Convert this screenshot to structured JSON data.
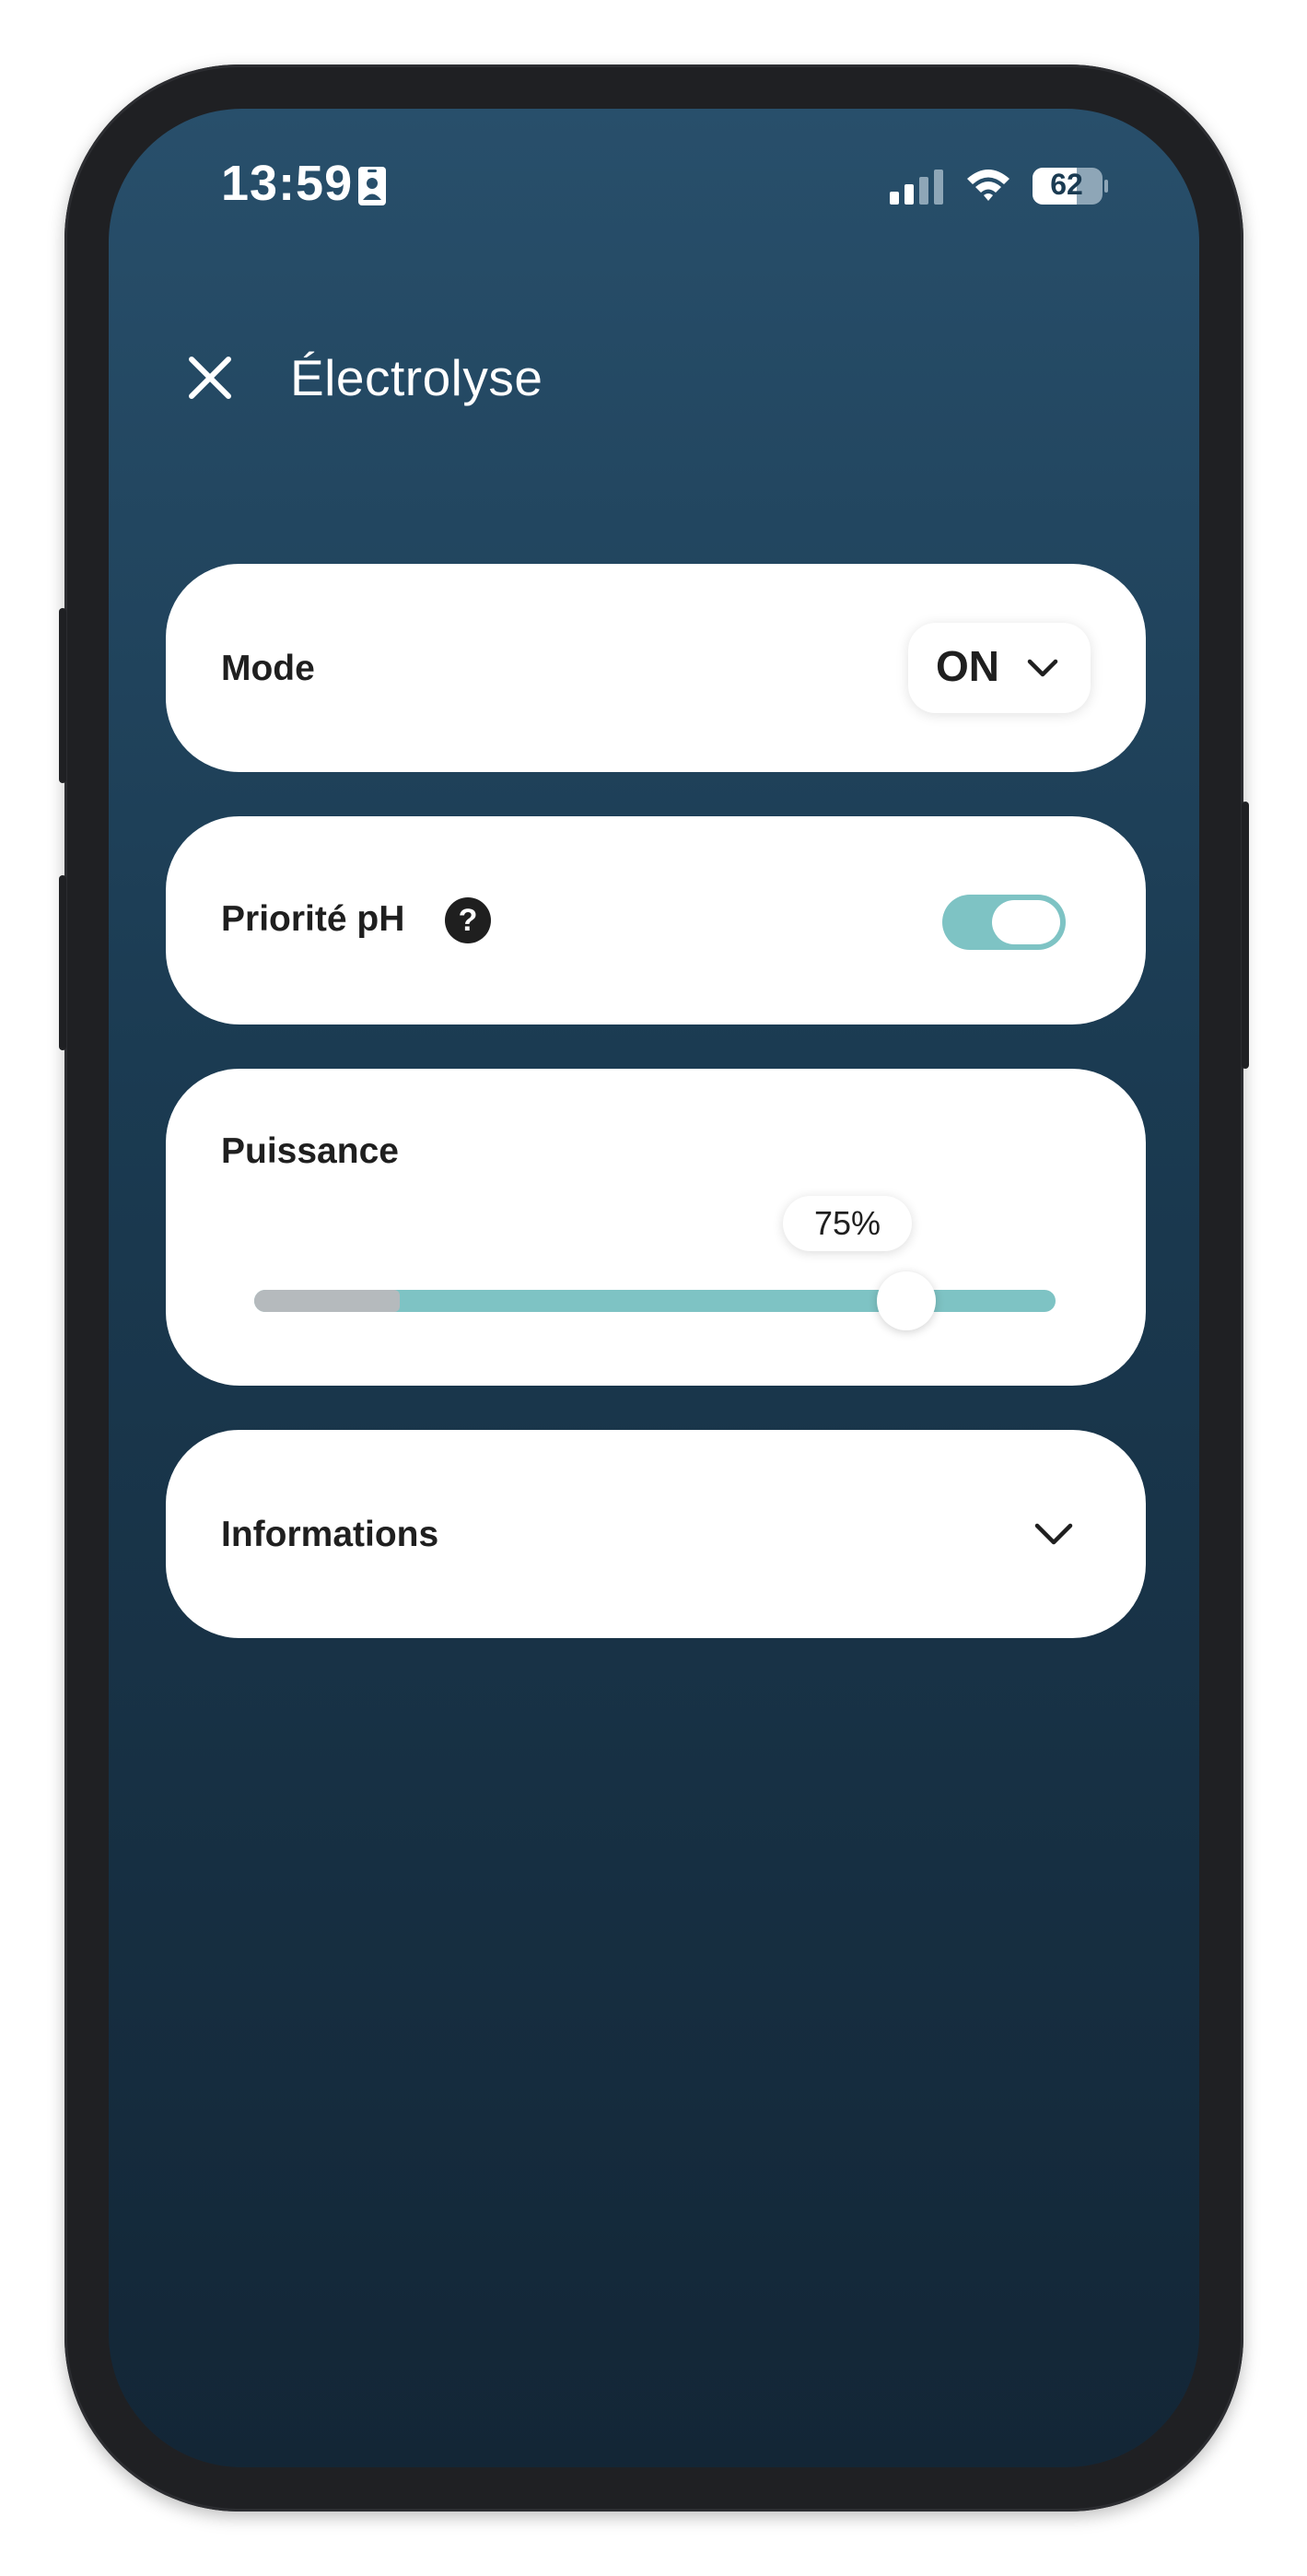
{
  "status_bar": {
    "time": "13:59",
    "battery": "62",
    "icons": [
      "contact-badge-icon",
      "cellular-signal-icon",
      "wifi-icon",
      "battery-icon"
    ]
  },
  "header": {
    "close_icon": "close-icon",
    "title": "Électrolyse"
  },
  "mode": {
    "label": "Mode",
    "value": "ON"
  },
  "ph_priority": {
    "label": "Priorité pH",
    "help": "?",
    "enabled": true
  },
  "power": {
    "label": "Puissance",
    "value_text": "75%",
    "value_percent": 75
  },
  "info": {
    "label": "Informations"
  },
  "colors": {
    "accent": "#7ec3c4",
    "background_top": "#284f6b",
    "background_bottom": "#132636",
    "card": "#ffffff",
    "slider_min_zone": "#b5babd"
  }
}
